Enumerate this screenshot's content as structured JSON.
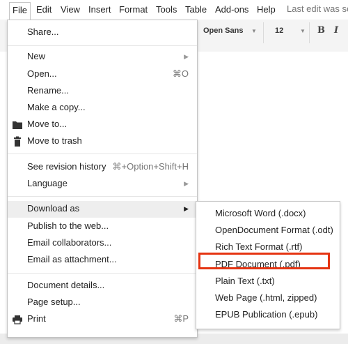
{
  "menubar": {
    "items": [
      "File",
      "Edit",
      "View",
      "Insert",
      "Format",
      "Tools",
      "Table",
      "Add-ons",
      "Help"
    ],
    "last_edit": "Last edit was se"
  },
  "toolbar": {
    "font_name": "Open Sans",
    "font_size": "12",
    "bold_label": "B",
    "italic_label": "I"
  },
  "file_menu": {
    "share": "Share...",
    "new": "New",
    "open": "Open...",
    "open_shortcut": "⌘O",
    "rename": "Rename...",
    "make_copy": "Make a copy...",
    "move_to": "Move to...",
    "move_to_trash": "Move to trash",
    "revision_history": "See revision history",
    "revision_shortcut": "⌘+Option+Shift+H",
    "language": "Language",
    "download_as": "Download as",
    "publish": "Publish to the web...",
    "email_collaborators": "Email collaborators...",
    "email_attachment": "Email as attachment...",
    "document_details": "Document details...",
    "page_setup": "Page setup...",
    "print": "Print",
    "print_shortcut": "⌘P"
  },
  "download_submenu": {
    "items": [
      "Microsoft Word (.docx)",
      "OpenDocument Format (.odt)",
      "Rich Text Format (.rtf)",
      "PDF Document (.pdf)",
      "Plain Text (.txt)",
      "Web Page (.html, zipped)",
      "EPUB Publication (.epub)"
    ],
    "highlight_color": "#e53412"
  },
  "icons": {
    "arrow": "▶",
    "caret": "▼",
    "folder": "folder-icon",
    "trash": "trash-icon",
    "print": "print-icon"
  }
}
